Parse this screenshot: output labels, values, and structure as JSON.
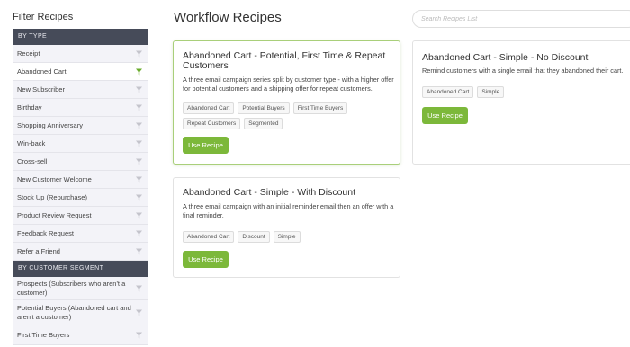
{
  "sidebar": {
    "title": "Filter Recipes",
    "by_type_header": "BY TYPE",
    "by_type_items": [
      {
        "label": "Receipt"
      },
      {
        "label": "Abandoned Cart",
        "active": true
      },
      {
        "label": "New Subscriber"
      },
      {
        "label": "Birthday"
      },
      {
        "label": "Shopping Anniversary"
      },
      {
        "label": "Win-back"
      },
      {
        "label": "Cross-sell"
      },
      {
        "label": "New Customer Welcome"
      },
      {
        "label": "Stock Up (Repurchase)"
      },
      {
        "label": "Product Review Request"
      },
      {
        "label": "Feedback Request"
      },
      {
        "label": "Refer a Friend"
      }
    ],
    "by_segment_header": "BY CUSTOMER SEGMENT",
    "by_segment_items": [
      {
        "label": "Prospects (Subscribers who aren't a customer)"
      },
      {
        "label": "Potential Buyers (Abandoned cart and aren't a customer)"
      },
      {
        "label": "First Time Buyers"
      }
    ]
  },
  "main": {
    "title": "Workflow Recipes",
    "search_placeholder": "Search Recipes List",
    "recipes": [
      {
        "title": "Abandoned Cart - Potential, First Time & Repeat Customers",
        "description": "A three email campaign series split by customer type - with a higher offer for potential customers and a shipping offer for repeat customers.",
        "tags": [
          "Abandoned Cart",
          "Potential Buyers",
          "First Time Buyers",
          "Repeat Customers",
          "Segmented"
        ],
        "button": "Use Recipe"
      },
      {
        "title": "Abandoned Cart - Simple - No Discount",
        "description": "Remind customers with a single email that they abandoned their cart.",
        "tags": [
          "Abandoned Cart",
          "Simple"
        ],
        "button": "Use Recipe"
      },
      {
        "title": "Abandoned Cart - Simple - With Discount",
        "description": "A three email campaign with an initial reminder email then an offer with a final reminder.",
        "tags": [
          "Abandoned Cart",
          "Discount",
          "Simple"
        ],
        "button": "Use Recipe"
      }
    ]
  },
  "colors": {
    "section_header": "#464b59",
    "accent_green": "#7cb83a",
    "active_funnel": "#6aac2c",
    "inactive_funnel": "#c4c4cc",
    "card_highlight_border": "#a9cf7a"
  },
  "icons": {
    "filter": "funnel-icon"
  }
}
